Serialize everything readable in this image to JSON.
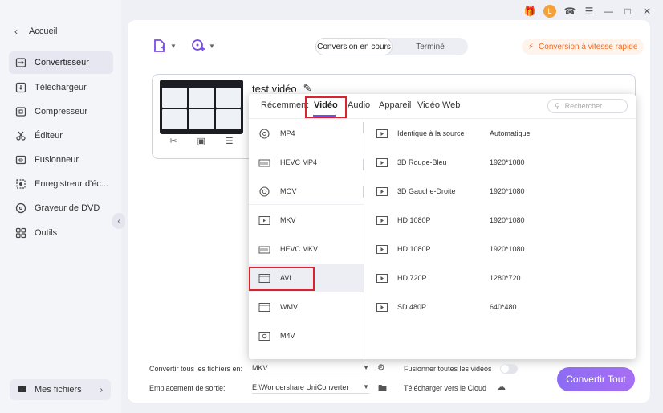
{
  "sidebar": {
    "back_label": "Accueil",
    "items": [
      {
        "label": "Convertisseur",
        "icon": "convert-icon",
        "active": true
      },
      {
        "label": "Téléchargeur",
        "icon": "download-icon"
      },
      {
        "label": "Compresseur",
        "icon": "compress-icon"
      },
      {
        "label": "Éditeur",
        "icon": "scissors-icon"
      },
      {
        "label": "Fusionneur",
        "icon": "merge-icon"
      },
      {
        "label": "Enregistreur d'éc...",
        "icon": "record-icon"
      },
      {
        "label": "Graveur de DVD",
        "icon": "disc-icon"
      },
      {
        "label": "Outils",
        "icon": "tools-icon"
      }
    ],
    "my_files": "Mes fichiers"
  },
  "header": {
    "segment": {
      "active": "Conversion en cours",
      "other": "Terminé"
    },
    "fast_label": "Conversion à vitesse rapide",
    "avatar_letter": "L"
  },
  "file": {
    "name": "test vidéo"
  },
  "format_panel": {
    "tabs": [
      "Récemment",
      "Vidéo",
      "Audio",
      "Appareil",
      "Vidéo Web"
    ],
    "active_tab": "Vidéo",
    "search_placeholder": "Rechercher",
    "formats": [
      {
        "label": "MP4",
        "icon": "mp4-icon"
      },
      {
        "label": "HEVC MP4",
        "icon": "hevc-icon"
      },
      {
        "label": "MOV",
        "icon": "mov-icon"
      },
      {
        "label": "MKV",
        "icon": "mkv-icon"
      },
      {
        "label": "HEVC MKV",
        "icon": "hevc-icon"
      },
      {
        "label": "AVI",
        "icon": "avi-icon",
        "selected": true
      },
      {
        "label": "WMV",
        "icon": "wmv-icon"
      },
      {
        "label": "M4V",
        "icon": "m4v-icon"
      }
    ],
    "resolutions": [
      {
        "name": "Identique à la source",
        "value": "Automatique"
      },
      {
        "name": "3D Rouge-Bleu",
        "value": "1920*1080"
      },
      {
        "name": "3D Gauche-Droite",
        "value": "1920*1080"
      },
      {
        "name": "HD 1080P",
        "value": "1920*1080"
      },
      {
        "name": "HD 1080P",
        "value": "1920*1080"
      },
      {
        "name": "HD 720P",
        "value": "1280*720"
      },
      {
        "name": "SD 480P",
        "value": "640*480"
      }
    ]
  },
  "footer": {
    "convert_all_label": "Convertir tous les fichiers en:",
    "convert_all_value": "MKV",
    "output_label": "Emplacement de sortie:",
    "output_value": "E:\\Wondershare UniConverter",
    "merge_label": "Fusionner toutes les vidéos",
    "cloud_label": "Télécharger vers le Cloud",
    "convert_button": "Convertir Tout"
  },
  "colors": {
    "accent": "#7b4ae8",
    "highlight": "#d9232e",
    "fast": "#f06a25"
  }
}
